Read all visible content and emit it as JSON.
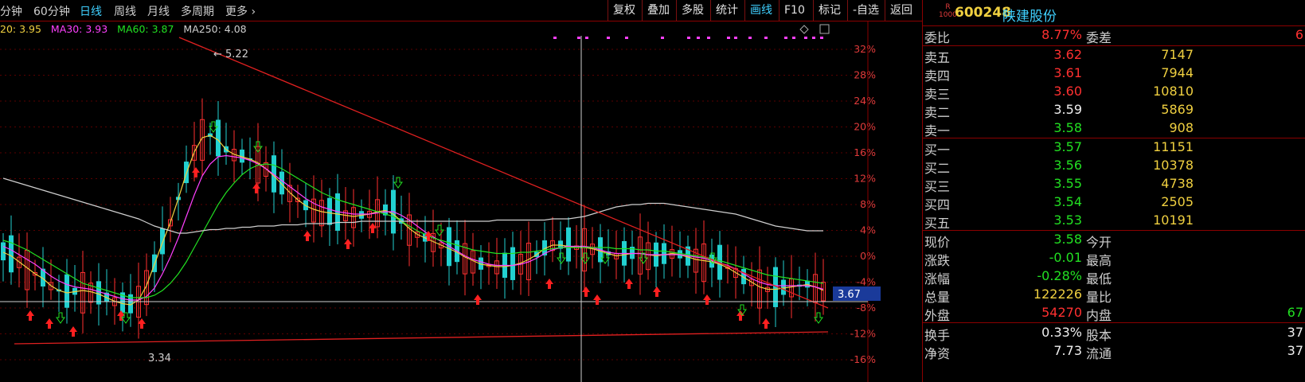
{
  "toolbar": {
    "timeframes": [
      {
        "label": "分钟"
      },
      {
        "label": "60分钟"
      },
      {
        "label": "日线",
        "active": true
      },
      {
        "label": "周线"
      },
      {
        "label": "月线"
      },
      {
        "label": "多周期"
      },
      {
        "label": "更多"
      }
    ],
    "tools": [
      {
        "label": "复权"
      },
      {
        "label": "叠加"
      },
      {
        "label": "多股"
      },
      {
        "label": "统计"
      },
      {
        "label": "画线",
        "active": true
      },
      {
        "label": "F10"
      },
      {
        "label": "标记"
      },
      {
        "label": "-自选"
      },
      {
        "label": "返回"
      }
    ]
  },
  "ma": {
    "ma20": "20: 3.95",
    "ma30": "MA30: 3.93",
    "ma60": "MA60: 3.87",
    "ma250": "MA250: 4.08",
    "colors": {
      "ma20": "#f0d040",
      "ma30": "#ff40ff",
      "ma60": "#22e022",
      "ma250": "#cfcfcf"
    }
  },
  "chart_data": {
    "type": "line",
    "title": "",
    "y_axis_labels": [
      "32%",
      "28%",
      "24%",
      "20%",
      "16%",
      "12%",
      "8%",
      "4%",
      "0%",
      "-4%",
      "-8%",
      "-12%",
      "-16%"
    ],
    "ylim_pct": [
      -16,
      32
    ],
    "current_price_marker": "3.67",
    "high_label": "5.22",
    "low_label": "3.34",
    "x": [
      0,
      10,
      20,
      30,
      40,
      50,
      60,
      70,
      80,
      90,
      100,
      110,
      120,
      130,
      140,
      150,
      160,
      170,
      180,
      190,
      200,
      210,
      220,
      230,
      240,
      250,
      260,
      270,
      280,
      290,
      300,
      310,
      320,
      330,
      340,
      350,
      360,
      370,
      380,
      390,
      400,
      410,
      420,
      430,
      440,
      450,
      460,
      470,
      480,
      490,
      500,
      510,
      520,
      530,
      540,
      550,
      560,
      570,
      580,
      590,
      600,
      610,
      620,
      630,
      640,
      650,
      660,
      670,
      680,
      690,
      700,
      710,
      720,
      730,
      740,
      750,
      760,
      770,
      780,
      790,
      800,
      810,
      820,
      830,
      840,
      850,
      860,
      870,
      880,
      890,
      900,
      910,
      920,
      930,
      940,
      950,
      960,
      970,
      980,
      990,
      1000,
      1010,
      1020,
      1030
    ],
    "series": [
      {
        "name": "MA20",
        "color": "#f0d040",
        "values": [
          3.9,
          3.87,
          3.82,
          3.77,
          3.72,
          3.68,
          3.62,
          3.58,
          3.56,
          3.57,
          3.58,
          3.57,
          3.55,
          3.52,
          3.49,
          3.47,
          3.46,
          3.5,
          3.62,
          3.8,
          3.98,
          4.15,
          4.35,
          4.56,
          4.74,
          4.86,
          4.88,
          4.84,
          4.76,
          4.72,
          4.7,
          4.68,
          4.65,
          4.6,
          4.54,
          4.47,
          4.4,
          4.34,
          4.29,
          4.26,
          4.24,
          4.23,
          4.22,
          4.21,
          4.2,
          4.21,
          4.22,
          4.24,
          4.25,
          4.22,
          4.16,
          4.1,
          4.05,
          4.02,
          3.99,
          3.96,
          3.93,
          3.9,
          3.86,
          3.83,
          3.8,
          3.79,
          3.78,
          3.78,
          3.79,
          3.81,
          3.84,
          3.88,
          3.93,
          3.96,
          3.96,
          3.95,
          3.94,
          3.94,
          3.93,
          3.91,
          3.89,
          3.87,
          3.88,
          3.89,
          3.89,
          3.88,
          3.87,
          3.88,
          3.89,
          3.88,
          3.86,
          3.84,
          3.83,
          3.82,
          3.8,
          3.77,
          3.73,
          3.69,
          3.65,
          3.61,
          3.59,
          3.59,
          3.6,
          3.61,
          3.62,
          3.63,
          3.61,
          3.58
        ]
      },
      {
        "name": "MA30",
        "color": "#ff40ff",
        "values": [
          3.95,
          3.92,
          3.88,
          3.84,
          3.8,
          3.75,
          3.7,
          3.66,
          3.63,
          3.61,
          3.6,
          3.59,
          3.57,
          3.55,
          3.53,
          3.51,
          3.5,
          3.5,
          3.53,
          3.6,
          3.72,
          3.86,
          4.02,
          4.2,
          4.38,
          4.54,
          4.64,
          4.7,
          4.71,
          4.7,
          4.69,
          4.67,
          4.64,
          4.6,
          4.55,
          4.5,
          4.45,
          4.4,
          4.35,
          4.31,
          4.28,
          4.26,
          4.24,
          4.23,
          4.22,
          4.22,
          4.22,
          4.23,
          4.24,
          4.24,
          4.21,
          4.17,
          4.12,
          4.07,
          4.03,
          3.99,
          3.95,
          3.91,
          3.87,
          3.84,
          3.82,
          3.8,
          3.79,
          3.79,
          3.79,
          3.8,
          3.82,
          3.85,
          3.89,
          3.92,
          3.94,
          3.95,
          3.95,
          3.95,
          3.94,
          3.92,
          3.9,
          3.89,
          3.89,
          3.89,
          3.89,
          3.88,
          3.88,
          3.88,
          3.88,
          3.88,
          3.87,
          3.86,
          3.85,
          3.83,
          3.81,
          3.79,
          3.76,
          3.72,
          3.68,
          3.65,
          3.63,
          3.62,
          3.62,
          3.62,
          3.62,
          3.62,
          3.61,
          3.59
        ]
      },
      {
        "name": "MA60",
        "color": "#22e022",
        "values": [
          4.0,
          3.98,
          3.95,
          3.92,
          3.88,
          3.84,
          3.8,
          3.76,
          3.72,
          3.68,
          3.64,
          3.62,
          3.6,
          3.58,
          3.56,
          3.54,
          3.52,
          3.52,
          3.52,
          3.54,
          3.58,
          3.64,
          3.72,
          3.82,
          3.94,
          4.06,
          4.18,
          4.3,
          4.4,
          4.48,
          4.55,
          4.6,
          4.63,
          4.64,
          4.63,
          4.6,
          4.56,
          4.52,
          4.48,
          4.44,
          4.4,
          4.37,
          4.34,
          4.32,
          4.3,
          4.28,
          4.26,
          4.24,
          4.22,
          4.2,
          4.16,
          4.12,
          4.08,
          4.05,
          4.02,
          4.0,
          3.98,
          3.96,
          3.94,
          3.92,
          3.91,
          3.9,
          3.89,
          3.89,
          3.89,
          3.9,
          3.9,
          3.91,
          3.92,
          3.93,
          3.94,
          3.94,
          3.94,
          3.94,
          3.94,
          3.94,
          3.94,
          3.93,
          3.93,
          3.93,
          3.92,
          3.92,
          3.91,
          3.91,
          3.9,
          3.89,
          3.88,
          3.87,
          3.86,
          3.84,
          3.83,
          3.81,
          3.79,
          3.77,
          3.75,
          3.73,
          3.71,
          3.7,
          3.69,
          3.68,
          3.67,
          3.66,
          3.65,
          3.64
        ]
      },
      {
        "name": "MA250",
        "color": "#cfcfcf",
        "values": [
          4.52,
          4.5,
          4.48,
          4.46,
          4.44,
          4.42,
          4.4,
          4.38,
          4.36,
          4.34,
          4.32,
          4.3,
          4.28,
          4.26,
          4.24,
          4.22,
          4.2,
          4.18,
          4.15,
          4.12,
          4.1,
          4.08,
          4.06,
          4.06,
          4.07,
          4.08,
          4.09,
          4.09,
          4.1,
          4.1,
          4.11,
          4.11,
          4.12,
          4.12,
          4.12,
          4.13,
          4.13,
          4.13,
          4.14,
          4.14,
          4.14,
          4.14,
          4.15,
          4.15,
          4.15,
          4.16,
          4.16,
          4.16,
          4.16,
          4.16,
          4.16,
          4.16,
          4.16,
          4.16,
          4.16,
          4.16,
          4.16,
          4.16,
          4.16,
          4.16,
          4.16,
          4.16,
          4.17,
          4.17,
          4.17,
          4.17,
          4.17,
          4.17,
          4.17,
          4.18,
          4.18,
          4.18,
          4.19,
          4.2,
          4.22,
          4.24,
          4.26,
          4.28,
          4.29,
          4.3,
          4.3,
          4.31,
          4.31,
          4.31,
          4.3,
          4.29,
          4.28,
          4.27,
          4.26,
          4.25,
          4.24,
          4.23,
          4.22,
          4.2,
          4.18,
          4.16,
          4.14,
          4.12,
          4.11,
          4.1,
          4.09,
          4.08,
          4.08,
          4.08
        ]
      }
    ],
    "price_ylim": [
      3.0,
      5.6
    ]
  },
  "quote": {
    "badge": "R\n1000",
    "code": "600248",
    "name": "陕建股份",
    "ratio_label": "委比",
    "ratio_value": "8.77%",
    "diff_label": "委差",
    "diff_value": "6",
    "asks": [
      {
        "label": "卖五",
        "price": "3.62",
        "vol": "7147",
        "pc": "red"
      },
      {
        "label": "卖四",
        "price": "3.61",
        "vol": "7944",
        "pc": "red"
      },
      {
        "label": "卖三",
        "price": "3.60",
        "vol": "10810",
        "pc": "red"
      },
      {
        "label": "卖二",
        "price": "3.59",
        "vol": "5869",
        "pc": "white"
      },
      {
        "label": "卖一",
        "price": "3.58",
        "vol": "908",
        "pc": "green"
      }
    ],
    "bids": [
      {
        "label": "买一",
        "price": "3.57",
        "vol": "11151",
        "pc": "green"
      },
      {
        "label": "买二",
        "price": "3.56",
        "vol": "10378",
        "pc": "green"
      },
      {
        "label": "买三",
        "price": "3.55",
        "vol": "4738",
        "pc": "green"
      },
      {
        "label": "买四",
        "price": "3.54",
        "vol": "2505",
        "pc": "green"
      },
      {
        "label": "买五",
        "price": "3.53",
        "vol": "10191",
        "pc": "green"
      }
    ],
    "stats": [
      {
        "label": "现价",
        "value": "3.58",
        "vc": "green",
        "label2": "今开",
        "value2": ""
      },
      {
        "label": "涨跌",
        "value": "-0.01",
        "vc": "green",
        "label2": "最高",
        "value2": ""
      },
      {
        "label": "涨幅",
        "value": "-0.28%",
        "vc": "green",
        "label2": "最低",
        "value2": ""
      },
      {
        "label": "总量",
        "value": "122226",
        "vc": "yellow",
        "label2": "量比",
        "value2": ""
      },
      {
        "label": "外盘",
        "value": "54270",
        "vc": "red",
        "label2": "内盘",
        "value2": "67"
      },
      {
        "label": "换手",
        "value": "0.33%",
        "vc": "white",
        "label2": "股本",
        "value2": "37"
      },
      {
        "label": "净资",
        "value": "7.73",
        "vc": "white",
        "label2": "流通",
        "value2": "37"
      }
    ]
  }
}
